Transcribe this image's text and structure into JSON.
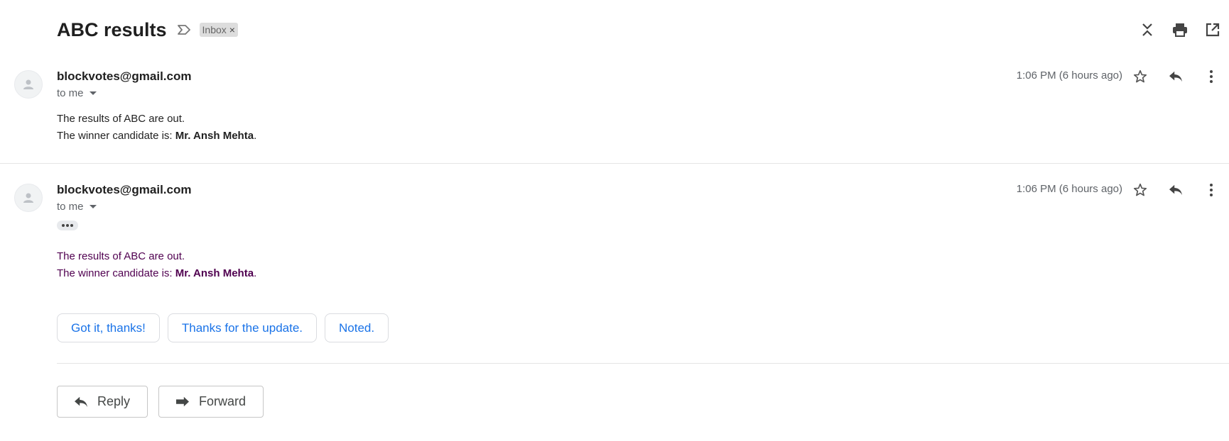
{
  "subject": "ABC results",
  "label": "Inbox",
  "label_remove": "×",
  "messages": [
    {
      "sender": "blockvotes@gmail.com",
      "to": "to me",
      "time": "1:06 PM (6 hours ago)",
      "line1": "The results of ABC are out.",
      "line2_prefix": "The winner candidate is: ",
      "line2_bold": "Mr. Ansh Mehta",
      "line2_suffix": "."
    },
    {
      "sender": "blockvotes@gmail.com",
      "to": "to me",
      "time": "1:06 PM (6 hours ago)",
      "line1": "The results of ABC are out.",
      "line2_prefix": "The winner candidate is: ",
      "line2_bold": "Mr. Ansh Mehta",
      "line2_suffix": "."
    }
  ],
  "smart_replies": [
    "Got it, thanks!",
    "Thanks for the update.",
    "Noted."
  ],
  "reply_label": "Reply",
  "forward_label": "Forward",
  "icons": {
    "importance": "importance-marker-icon",
    "collapse": "collapse-all-icon",
    "print": "print-icon",
    "new_window": "open-in-new-window-icon",
    "avatar": "person-icon",
    "star": "star-icon",
    "reply": "reply-icon",
    "more": "more-vert-icon",
    "forward": "forward-icon"
  },
  "colors": {
    "link_blue": "#1a73e8",
    "quoted_purple": "#500050"
  }
}
